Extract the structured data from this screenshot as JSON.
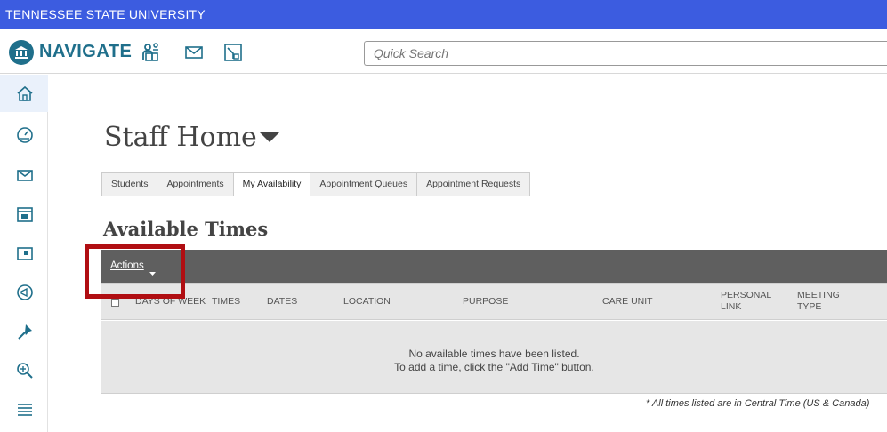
{
  "topbar": {
    "institution": "TENNESSEE STATE UNIVERSITY"
  },
  "navbar": {
    "brand": "NAVIGATE",
    "icons": [
      "staff-icon",
      "mail-icon",
      "reports-icon"
    ],
    "search_placeholder": "Quick Search"
  },
  "sidebar": {
    "items": [
      "home-icon",
      "dashboard-icon",
      "mail-icon",
      "calendar-icon",
      "folder-icon",
      "campaign-icon",
      "pin-icon",
      "search-icon",
      "list-icon"
    ],
    "active_index": 0
  },
  "page": {
    "title": "Staff Home"
  },
  "tabs": [
    {
      "label": "Students"
    },
    {
      "label": "Appointments"
    },
    {
      "label": "My Availability",
      "active": true
    },
    {
      "label": "Appointment Queues"
    },
    {
      "label": "Appointment Requests"
    }
  ],
  "section": {
    "title": "Available Times"
  },
  "actions": {
    "label": "Actions"
  },
  "table": {
    "columns": [
      "DAYS OF WEEK",
      "TIMES",
      "DATES",
      "LOCATION",
      "PURPOSE",
      "CARE UNIT",
      "PERSONAL LINK",
      "MEETING TYPE"
    ],
    "col_lines": [
      [
        "DAYS OF WEEK"
      ],
      [
        "TIMES"
      ],
      [
        "DATES"
      ],
      [
        "LOCATION"
      ],
      [
        "PURPOSE"
      ],
      [
        "CARE UNIT"
      ],
      [
        "PERSONAL",
        "LINK"
      ],
      [
        "MEETING",
        "TYPE"
      ]
    ],
    "empty_line1": "No available times have been listed.",
    "empty_line2": "To add a time, click the \"Add Time\" button."
  },
  "footnote": "* All times listed are in Central Time (US & Canada)",
  "colors": {
    "topbar": "#3c5ce0",
    "brand": "#1f6f8b",
    "actions_bar": "#5f5f5f",
    "highlight": "#b00e12"
  }
}
